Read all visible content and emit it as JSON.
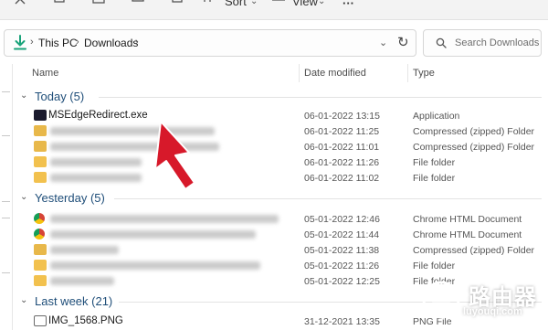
{
  "toolbar": {
    "sort_label": "Sort",
    "view_label": "View",
    "more_label": "···"
  },
  "address": {
    "crumbs": [
      "This PC",
      "Downloads"
    ]
  },
  "search": {
    "placeholder": "Search Downloads"
  },
  "columns": {
    "name": "Name",
    "date": "Date modified",
    "type": "Type"
  },
  "groups": [
    {
      "label": "Today (5)",
      "rows": [
        {
          "name": "MSEdgeRedirect.exe",
          "date": "06-01-2022 13:15",
          "type": "Application",
          "icon": "exe-icon"
        },
        {
          "name": "",
          "date": "06-01-2022 11:25",
          "type": "Compressed (zipped) Folder",
          "icon": "zip-folder-icon"
        },
        {
          "name": "",
          "date": "06-01-2022 11:01",
          "type": "Compressed (zipped) Folder",
          "icon": "zip-folder-icon"
        },
        {
          "name": "",
          "date": "06-01-2022 11:26",
          "type": "File folder",
          "icon": "folder-icon"
        },
        {
          "name": "",
          "date": "06-01-2022 11:02",
          "type": "File folder",
          "icon": "folder-icon"
        }
      ]
    },
    {
      "label": "Yesterday (5)",
      "rows": [
        {
          "name": "",
          "date": "05-01-2022 12:46",
          "type": "Chrome HTML Document",
          "icon": "chrome-icon"
        },
        {
          "name": "",
          "date": "05-01-2022 11:44",
          "type": "Chrome HTML Document",
          "icon": "chrome-icon"
        },
        {
          "name": "",
          "date": "05-01-2022 11:38",
          "type": "Compressed (zipped) Folder",
          "icon": "zip-folder-icon"
        },
        {
          "name": "",
          "date": "05-01-2022 11:26",
          "type": "File folder",
          "icon": "folder-icon"
        },
        {
          "name": "",
          "date": "05-01-2022 12:25",
          "type": "File folder",
          "icon": "folder-icon"
        }
      ]
    },
    {
      "label": "Last week (21)",
      "rows": [
        {
          "name": "IMG_1568.PNG",
          "date": "31-12-2021 13:35",
          "type": "PNG File",
          "icon": "png-file-icon"
        }
      ]
    }
  ],
  "watermark": {
    "text": "路由器",
    "sub": "luyouqi.com"
  },
  "colors": {
    "accent_arrow": "#d7192a",
    "group_label": "#1f4e79",
    "download_icon": "#1aa37a"
  }
}
